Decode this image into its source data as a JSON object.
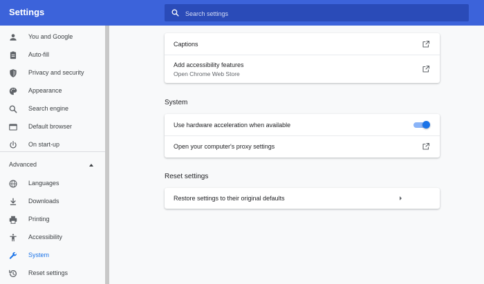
{
  "app": {
    "title": "Settings"
  },
  "search": {
    "placeholder": "Search settings"
  },
  "sidebar": {
    "items": [
      {
        "label": "You and Google",
        "icon": "person-icon"
      },
      {
        "label": "Auto-fill",
        "icon": "clipboard-icon"
      },
      {
        "label": "Privacy and security",
        "icon": "shield-icon"
      },
      {
        "label": "Appearance",
        "icon": "palette-icon"
      },
      {
        "label": "Search engine",
        "icon": "search-icon"
      },
      {
        "label": "Default browser",
        "icon": "browser-window-icon"
      },
      {
        "label": "On start-up",
        "icon": "power-icon"
      }
    ],
    "advanced_label": "Advanced",
    "advanced_items": [
      {
        "label": "Languages",
        "icon": "globe-icon"
      },
      {
        "label": "Downloads",
        "icon": "download-icon"
      },
      {
        "label": "Printing",
        "icon": "printer-icon"
      },
      {
        "label": "Accessibility",
        "icon": "accessibility-icon"
      },
      {
        "label": "System",
        "icon": "wrench-icon",
        "active": true
      },
      {
        "label": "Reset settings",
        "icon": "history-icon"
      }
    ]
  },
  "main": {
    "accessibility_card": {
      "captions_label": "Captions",
      "add_features_label": "Add accessibility features",
      "add_features_sub": "Open Chrome Web Store"
    },
    "system": {
      "title": "System",
      "hardware_accel_label": "Use hardware acceleration when available",
      "hardware_accel_on": true,
      "proxy_label": "Open your computer's proxy settings"
    },
    "reset": {
      "title": "Reset settings",
      "restore_label": "Restore settings to their original defaults"
    }
  },
  "colors": {
    "header": "#3c63da",
    "accent": "#1a73e8",
    "toggle_track": "#8ab4f8"
  }
}
